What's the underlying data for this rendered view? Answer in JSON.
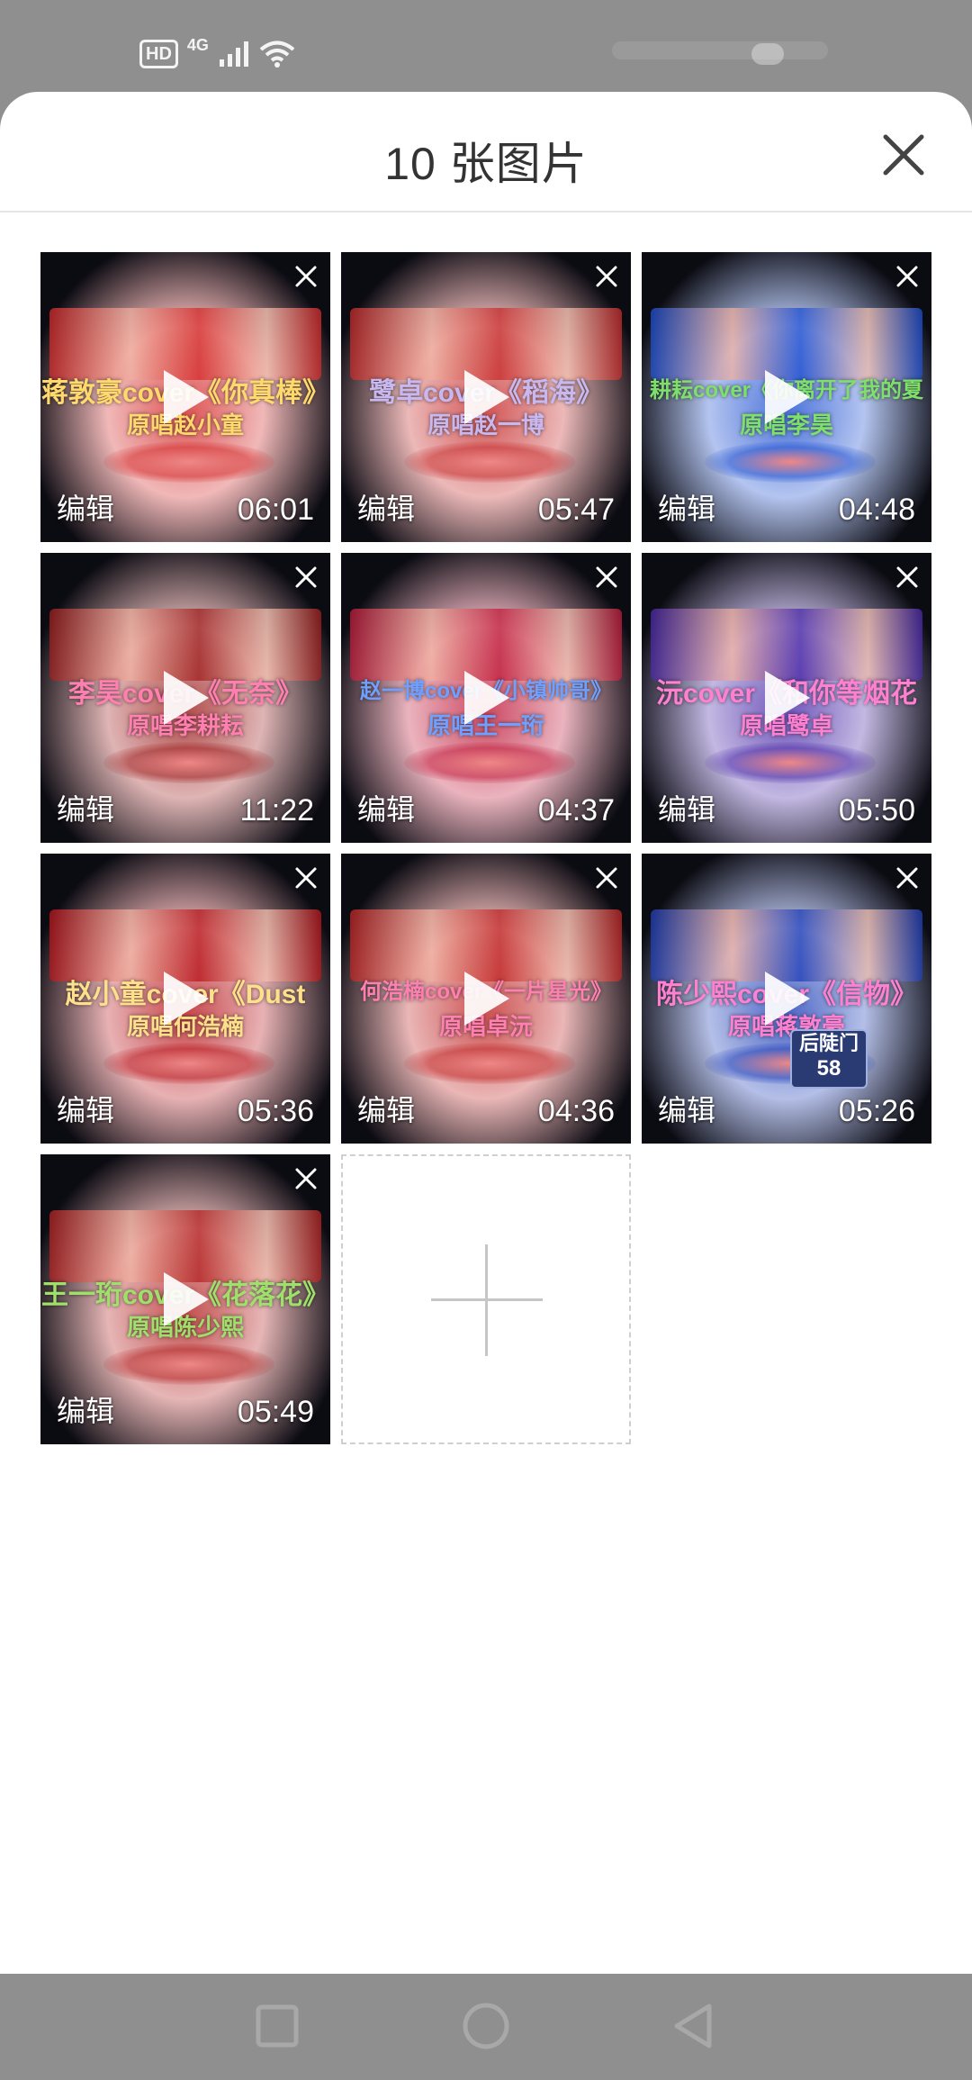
{
  "status_bar": {
    "hd_badge": "HD",
    "network_label": "4G",
    "icons": [
      "signal-icon",
      "wifi-icon"
    ]
  },
  "sheet": {
    "title": "10 张图片",
    "close_icon": "close-icon"
  },
  "videos": [
    {
      "overlay_line1": "蒋敦豪cover《你真棒》",
      "overlay_line2": "原唱赵小童",
      "edit_label": "编辑",
      "duration": "06:01",
      "text_color": "#ffd96b",
      "scene_color": "#d42a2a"
    },
    {
      "overlay_line1": "鹭卓cover《稻海》",
      "overlay_line2": "原唱赵一博",
      "edit_label": "编辑",
      "duration": "05:47",
      "text_color": "#c9b8f0",
      "scene_color": "#c62b2b"
    },
    {
      "overlay_line1": "耕耘cover《你离开了我的夏",
      "overlay_line2": "原唱李昊",
      "edit_label": "编辑",
      "duration": "04:48",
      "text_color": "#7ee06b",
      "scene_color": "#1d4fd1"
    },
    {
      "overlay_line1": "李昊cover《无奈》",
      "overlay_line2": "原唱李耕耘",
      "edit_label": "编辑",
      "duration": "11:22",
      "text_color": "#ff7fb0",
      "scene_color": "#9e1f1f"
    },
    {
      "overlay_line1": "赵一博cover《小镇帅哥》",
      "overlay_line2": "原唱王一珩",
      "edit_label": "编辑",
      "duration": "04:37",
      "text_color": "#6fa0ff",
      "scene_color": "#c01c3c"
    },
    {
      "overlay_line1": "沅cover《和你等烟花",
      "overlay_line2": "原唱鹭卓",
      "edit_label": "编辑",
      "duration": "05:50",
      "text_color": "#ff7fd0",
      "scene_color": "#4a2aa8"
    },
    {
      "overlay_line1": "赵小童cover《Dust",
      "overlay_line2": "原唱何浩楠",
      "edit_label": "编辑",
      "duration": "05:36",
      "text_color": "#ffe08a",
      "scene_color": "#b8161c"
    },
    {
      "overlay_line1": "何浩楠cover《一片星光》",
      "overlay_line2": "原唱卓沅",
      "edit_label": "编辑",
      "duration": "04:36",
      "text_color": "#ff7fb0",
      "scene_color": "#c02525"
    },
    {
      "overlay_line1": "陈少熙cover《信物》",
      "overlay_line2": "原唱蒋敦豪",
      "edit_label": "编辑",
      "duration": "05:26",
      "text_color": "#ff7fd0",
      "scene_color": "#1f3fb8",
      "sign_line1": "后陡门",
      "sign_line2": "58"
    },
    {
      "overlay_line1": "王一珩cover《花落花》",
      "overlay_line2": "原唱陈少熙",
      "edit_label": "编辑",
      "duration": "05:49",
      "text_color": "#9fe06b",
      "scene_color": "#b32222"
    }
  ],
  "add_tile": {
    "icon": "plus-icon"
  },
  "nav_bar": {
    "icons": [
      "recents-icon",
      "home-icon",
      "back-icon"
    ]
  }
}
